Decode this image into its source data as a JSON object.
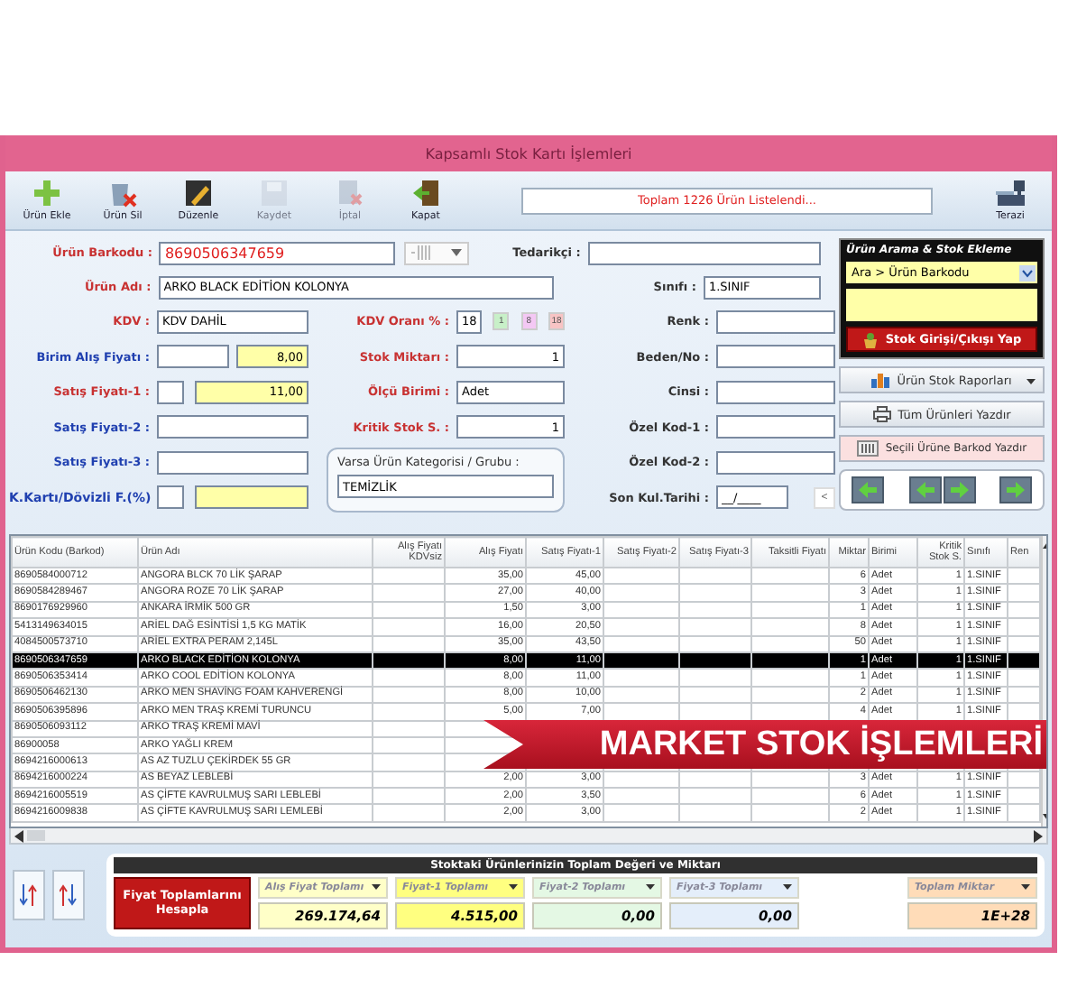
{
  "window": {
    "title": "Kapsamlı Stok Kartı İşlemleri"
  },
  "toolbar": {
    "buttons": [
      {
        "label": "Ürün Ekle",
        "kind": "add",
        "disabled": false
      },
      {
        "label": "Ürün Sil",
        "kind": "delete",
        "disabled": false
      },
      {
        "label": "Düzenle",
        "kind": "edit",
        "disabled": false
      },
      {
        "label": "Kaydet",
        "kind": "save",
        "disabled": true
      },
      {
        "label": "İptal",
        "kind": "cancel",
        "disabled": true
      },
      {
        "label": "Kapat",
        "kind": "close",
        "disabled": false
      }
    ],
    "message": "Toplam 1226 Ürün Listelendi...",
    "scale_button": "Terazi"
  },
  "form": {
    "barcode": {
      "label": "Ürün Barkodu :",
      "value": "8690506347659",
      "color": "#c83232"
    },
    "supplier": {
      "label": "Tedarikçi :",
      "color": "#333333"
    },
    "name": {
      "label": "Ürün Adı :",
      "value": "ARKO BLACK EDİTİON KOLONYA",
      "color": "#c83232"
    },
    "class": {
      "label": "Sınıfı :",
      "value": "1.SINIF",
      "color": "#333333"
    },
    "kdv": {
      "label": "KDV :",
      "value": "KDV DAHİL",
      "color": "#c83232"
    },
    "kdv_rate": {
      "label": "KDV Oranı % :",
      "value": "18",
      "color": "#c83232",
      "options": [
        {
          "label": "1",
          "color": "#c8f0c8"
        },
        {
          "label": "8",
          "color": "#f4c8f4"
        },
        {
          "label": "18",
          "color": "#f8c4c4"
        }
      ]
    },
    "colour": {
      "label": "Renk :",
      "color": "#333333"
    },
    "purchase_price": {
      "label": "Birim Alış Fiyatı :",
      "value": "8,00",
      "color": "#2040b0"
    },
    "stock": {
      "label": "Stok Miktarı :",
      "value": "1",
      "color": "#c83232"
    },
    "size": {
      "label": "Beden/No :",
      "color": "#333333"
    },
    "price1": {
      "label": "Satış Fiyatı-1 :",
      "value": "11,00",
      "color": "#c83232"
    },
    "unit": {
      "label": "Ölçü Birimi :",
      "value": "Adet",
      "color": "#c83232"
    },
    "type": {
      "label": "Cinsi :",
      "color": "#333333"
    },
    "price2": {
      "label": "Satış Fiyatı-2 :",
      "color": "#2040b0"
    },
    "critical": {
      "label": "Kritik Stok S. :",
      "value": "1",
      "color": "#c83232"
    },
    "code1": {
      "label": "Özel Kod-1 :",
      "color": "#333333"
    },
    "price3": {
      "label": "Satış Fiyatı-3 :",
      "color": "#2040b0"
    },
    "category": {
      "label": "Varsa Ürün Kategorisi / Grubu :",
      "value": "TEMİZLİK"
    },
    "code2": {
      "label": "Özel Kod-2 :",
      "color": "#333333"
    },
    "card_rate": {
      "label": "K.Kartı/Dövizli F.(%)",
      "color": "#2040b0"
    },
    "expiry": {
      "label": "Son Kul.Tarihi :",
      "value": "__/____",
      "color": "#333333",
      "button": "<"
    }
  },
  "search_panel": {
    "title": "Ürün Arama & Stok Ekleme",
    "search_by": "Ara > Ürün Barkodu",
    "action": "Stok Girişi/Çıkışı Yap"
  },
  "side_buttons": [
    {
      "label": "Ürün Stok Raporları",
      "kind": "report"
    },
    {
      "label": "Tüm Ürünleri Yazdır",
      "kind": "print"
    },
    {
      "label": "Seçili Ürüne Barkod Yazdır",
      "kind": "barcode"
    }
  ],
  "table": {
    "columns": [
      "Ürün Kodu (Barkod)",
      "Ürün Adı",
      "Alış Fiyatı KDVsiz",
      "Alış Fiyatı",
      "Satış Fiyatı-1",
      "Satış Fiyatı-2",
      "Satış Fiyatı-3",
      "Taksitli Fiyatı",
      "Miktar",
      "Birimi",
      "Kritik Stok S.",
      "Sınıfı",
      "Ren"
    ],
    "rows": [
      {
        "code": "8690584000712",
        "name": "ANGORA BLCK 70 LİK ŞARAP",
        "purchase": "35,00",
        "price1": "45,00",
        "quantity": "6",
        "unit": "Adet",
        "critical": "1",
        "class": "1.SINIF",
        "selected": false
      },
      {
        "code": "8690584289467",
        "name": "ANGORA ROZE 70 LİK ŞARAP",
        "purchase": "27,00",
        "price1": "40,00",
        "quantity": "3",
        "unit": "Adet",
        "critical": "1",
        "class": "1.SINIF",
        "selected": false
      },
      {
        "code": "8690176929960",
        "name": "ANKARA İRMİK 500 GR",
        "purchase": "1,50",
        "price1": "3,00",
        "quantity": "1",
        "unit": "Adet",
        "critical": "1",
        "class": "1.SINIF",
        "selected": false
      },
      {
        "code": "5413149634015",
        "name": "ARİEL DAĞ ESİNTİSİ 1,5 KG MATİK",
        "purchase": "16,00",
        "price1": "20,50",
        "quantity": "8",
        "unit": "Adet",
        "critical": "1",
        "class": "1.SINIF",
        "selected": false
      },
      {
        "code": "4084500573710",
        "name": "ARİEL EXTRA PERAM 2,145L",
        "purchase": "35,00",
        "price1": "43,50",
        "quantity": "50",
        "unit": "Adet",
        "critical": "1",
        "class": "1.SINIF",
        "selected": false
      },
      {
        "code": "8690506347659",
        "name": "ARKO BLACK EDİTİON KOLONYA",
        "purchase": "8,00",
        "price1": "11,00",
        "quantity": "1",
        "unit": "Adet",
        "critical": "1",
        "class": "1.SINIF",
        "selected": true
      },
      {
        "code": "8690506353414",
        "name": "ARKO COOL EDİTİON KOLONYA",
        "purchase": "8,00",
        "price1": "11,00",
        "quantity": "1",
        "unit": "Adet",
        "critical": "1",
        "class": "1.SINIF",
        "selected": false
      },
      {
        "code": "8690506462130",
        "name": "ARKO MEN SHAVİNG FOAM KAHVERENGİ",
        "purchase": "8,00",
        "price1": "10,00",
        "quantity": "2",
        "unit": "Adet",
        "critical": "1",
        "class": "1.SINIF",
        "selected": false
      },
      {
        "code": "8690506395896",
        "name": "ARKO MEN TRAŞ KREMİ TURUNCU",
        "purchase": "5,00",
        "price1": "7,00",
        "quantity": "4",
        "unit": "Adet",
        "critical": "1",
        "class": "1.SINIF",
        "selected": false
      },
      {
        "code": "8690506093112",
        "name": "ARKO TRAŞ KREMİ MAVİ",
        "selected": false
      },
      {
        "code": "86900058",
        "name": "ARKO YAĞLI KREM",
        "selected": false
      },
      {
        "code": "8694216000613",
        "name": "AS AZ TUZLU  ÇEKİRDEK  55 GR",
        "selected": false
      },
      {
        "code": "8694216000224",
        "name": "AS BEYAZ LEBLEBİ",
        "purchase": "2,00",
        "price1": "3,00",
        "quantity": "3",
        "unit": "Adet",
        "critical": "1",
        "class": "1.SINIF",
        "selected": false
      },
      {
        "code": "8694216005519",
        "name": "AS ÇİFTE KAVRULMUŞ SARI LEBLEBİ",
        "purchase": "2,00",
        "price1": "3,50",
        "quantity": "6",
        "unit": "Adet",
        "critical": "1",
        "class": "1.SINIF",
        "selected": false
      },
      {
        "code": "8694216009838",
        "name": "AS ÇİFTE KAVRULMUŞ SARI LEMLEBİ",
        "purchase": "2,00",
        "price1": "3,00",
        "quantity": "2",
        "unit": "Adet",
        "critical": "1",
        "class": "1.SINIF",
        "selected": false
      }
    ]
  },
  "banner": {
    "text": "MARKET STOK İŞLEMLERİ"
  },
  "totals": {
    "title": "Stoktaki Ürünlerinizin Toplam Değeri ve Miktarı",
    "calculate_button": "Fiyat Toplamlarını Hesapla",
    "items": [
      {
        "label": "Alış Fiyat Toplamı",
        "value": "269.174,64",
        "color": "#ffffc8",
        "kind": "price"
      },
      {
        "label": "Fiyat-1 Toplamı",
        "value": "4.515,00",
        "color": "#ffff80",
        "kind": "price"
      },
      {
        "label": "Fiyat-2 Toplamı",
        "value": "0,00",
        "color": "#e4f8e4",
        "kind": "price"
      },
      {
        "label": "Fiyat-3 Toplamı",
        "value": "0,00",
        "color": "#e4eefa",
        "kind": "price"
      },
      {
        "label": "Toplam Miktar",
        "value": "1E+28",
        "color": "#ffdcb8",
        "kind": "quantity"
      }
    ]
  }
}
